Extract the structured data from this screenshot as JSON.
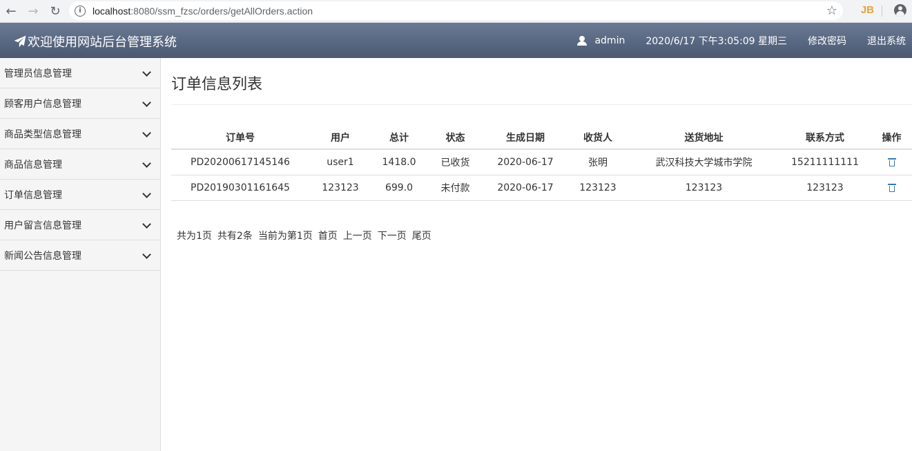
{
  "browser": {
    "url_host": "localhost",
    "url_rest": ":8080/ssm_fzsc/orders/getAllOrders.action",
    "ext_label": "JB"
  },
  "header": {
    "brand": "欢迎使用网站后台管理系统",
    "username": "admin",
    "datetime": "2020/6/17 下午3:05:09 星期三",
    "change_password": "修改密码",
    "logout": "退出系统"
  },
  "sidebar": {
    "items": [
      {
        "label": "管理员信息管理"
      },
      {
        "label": "顾客用户信息管理"
      },
      {
        "label": "商品类型信息管理"
      },
      {
        "label": "商品信息管理"
      },
      {
        "label": "订单信息管理"
      },
      {
        "label": "用户留言信息管理"
      },
      {
        "label": "新闻公告信息管理"
      }
    ]
  },
  "main": {
    "title": "订单信息列表",
    "table": {
      "headers": [
        "订单号",
        "用户",
        "总计",
        "状态",
        "生成日期",
        "收货人",
        "送货地址",
        "联系方式",
        "操作"
      ],
      "rows": [
        [
          "PD20200617145146",
          "user1",
          "1418.0",
          "已收货",
          "2020-06-17",
          "张明",
          "武汉科技大学城市学院",
          "15211111111"
        ],
        [
          "PD20190301161645",
          "123123",
          "699.0",
          "未付款",
          "2020-06-17",
          "123123",
          "123123",
          "123123"
        ]
      ]
    },
    "pager": {
      "total_pages": "共为1页",
      "total_items": "共有2条",
      "current_page": "当前为第1页",
      "first": "首页",
      "prev": "上一页",
      "next": "下一页",
      "last": "尾页"
    }
  },
  "colors": {
    "header_bg": "#5a6882",
    "link_blue": "#337ab7"
  }
}
